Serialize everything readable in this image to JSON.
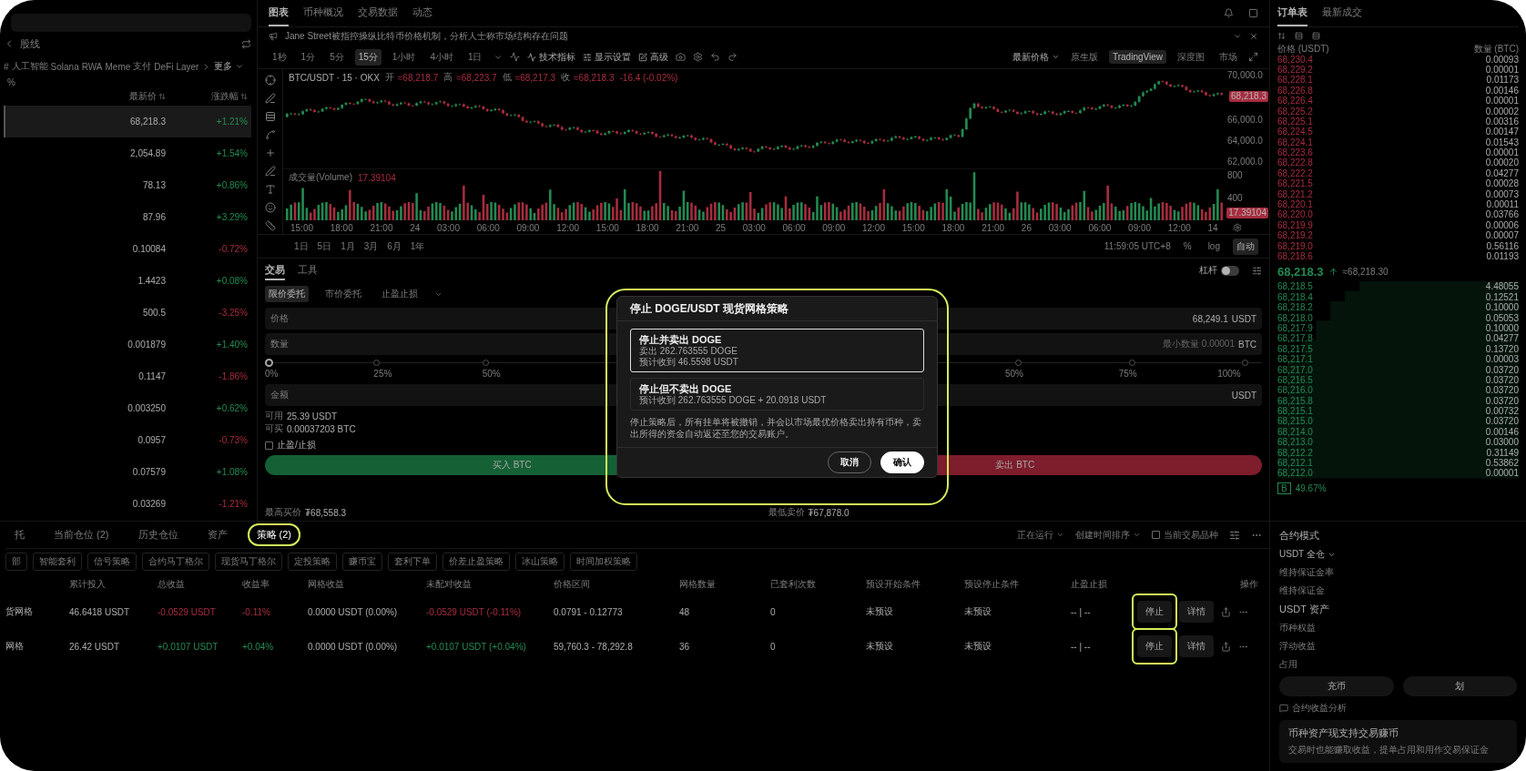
{
  "sidebar": {
    "title": "股线",
    "categories": [
      "#",
      "人工智能",
      "Solana",
      "RWA",
      "Meme",
      "支付",
      "DeFi",
      "Layer"
    ],
    "more": "更多",
    "filter": "%",
    "columns": [
      "最新价",
      "涨跌幅"
    ],
    "rows": [
      {
        "price": "68,218.3",
        "change": "+1.21%",
        "rising": true,
        "selected": true
      },
      {
        "price": "2,054.89",
        "change": "+1.54%",
        "rising": true,
        "selected": false
      },
      {
        "price": "78.13",
        "change": "+0.86%",
        "rising": true,
        "selected": false
      },
      {
        "price": "87.96",
        "change": "+3.29%",
        "rising": true,
        "selected": false
      },
      {
        "price": "0.10084",
        "change": "-0.72%",
        "rising": false,
        "selected": false
      },
      {
        "price": "1.4423",
        "change": "+0.08%",
        "rising": true,
        "selected": false
      },
      {
        "price": "500.5",
        "change": "-3.25%",
        "rising": false,
        "selected": false
      },
      {
        "price": "0.001879",
        "change": "+1.40%",
        "rising": true,
        "selected": false
      },
      {
        "price": "0.1147",
        "change": "-1.86%",
        "rising": false,
        "selected": false
      },
      {
        "price": "0.003250",
        "change": "+0.62%",
        "rising": true,
        "selected": false
      },
      {
        "price": "0.0957",
        "change": "-0.73%",
        "rising": false,
        "selected": false
      },
      {
        "price": "0.07579",
        "change": "+1.08%",
        "rising": true,
        "selected": false
      },
      {
        "price": "0.03269",
        "change": "-1.21%",
        "rising": false,
        "selected": false
      }
    ]
  },
  "chart": {
    "tabs": [
      {
        "label": "图表",
        "selected": true
      },
      {
        "label": "币种概况",
        "selected": false
      },
      {
        "label": "交易数据",
        "selected": false
      },
      {
        "label": "动态",
        "selected": false
      }
    ],
    "notice": "Jane Street被指控操纵比特币价格机制，分析人士称市场结构存在问题",
    "intervals": [
      {
        "label": "1秒",
        "selected": false
      },
      {
        "label": "1分",
        "selected": false
      },
      {
        "label": "5分",
        "selected": false
      },
      {
        "label": "15分",
        "selected": true
      },
      {
        "label": "1小时",
        "selected": false
      },
      {
        "label": "4小时",
        "selected": false
      },
      {
        "label": "1日",
        "selected": false
      }
    ],
    "tools": [
      "技术指标",
      "显示设置",
      "高级"
    ],
    "price_mode": "最新价格",
    "views": [
      {
        "label": "原生版",
        "selected": false
      },
      {
        "label": "TradingView",
        "selected": true
      },
      {
        "label": "深度图",
        "selected": false
      },
      {
        "label": "市场",
        "selected": false
      }
    ],
    "symbol": "BTC/USDT · 15 · OKX",
    "ohlc": [
      {
        "label": "开",
        "value": "≈68,218.7"
      },
      {
        "label": "高",
        "value": "≈68,223.7"
      },
      {
        "label": "低",
        "value": "≈68,217.3"
      },
      {
        "label": "收",
        "value": "≈68,218.3"
      }
    ],
    "ohlc_change": "-16.4 (-0.02%)",
    "price_ticks": [
      "70,000.0",
      "66,000.0",
      "64,000.0",
      "62,000.0"
    ],
    "last_price": "68,218.3",
    "volume_label": "成交量(Volume)",
    "volume_value": "17.39104",
    "volume_ticks": [
      "800",
      "400"
    ],
    "volume_tag": "17.39104",
    "time_ticks": [
      "15:00",
      "18:00",
      "21:00",
      "24",
      "03:00",
      "06:00",
      "09:00",
      "12:00",
      "15:00",
      "18:00",
      "21:00",
      "25",
      "03:00",
      "06:00",
      "09:00",
      "12:00",
      "15:00",
      "18:00",
      "21:00",
      "26",
      "03:00",
      "06:00",
      "09:00",
      "12:00",
      "14"
    ],
    "ranges": [
      "1日",
      "5日",
      "1月",
      "3月",
      "6月",
      "1年"
    ],
    "clock": "11:59:05 UTC+8",
    "scale_buttons": [
      {
        "label": "%",
        "selected": false
      },
      {
        "label": "log",
        "selected": false
      },
      {
        "label": "自动",
        "selected": true
      }
    ]
  },
  "trade": {
    "tabs": [
      {
        "label": "交易",
        "selected": true
      },
      {
        "label": "工具",
        "selected": false
      }
    ],
    "leverage": {
      "label": "杠杆",
      "on": false
    },
    "order_types": [
      {
        "label": "限价委托",
        "selected": true
      },
      {
        "label": "市价委托",
        "selected": false
      },
      {
        "label": "止盈止损",
        "selected": false
      }
    ],
    "price_field": {
      "label": "价格",
      "value": "68,249.1",
      "unit": "USDT"
    },
    "amount_field": {
      "label": "数量",
      "placeholder": "最小数量 0.00001",
      "unit": "BTC"
    },
    "buy_slider": {
      "level": 0,
      "marks": [
        "0%",
        "25%",
        "50%"
      ]
    },
    "sell_slider": {
      "level": 0,
      "marks": [
        "50%",
        "75%",
        "100%"
      ]
    },
    "total_field": {
      "label": "金额",
      "unit": "USDT"
    },
    "available": [
      {
        "label": "可用",
        "value": "25.39 USDT"
      },
      {
        "label": "可买",
        "value": "0.00037203 BTC"
      }
    ],
    "tpsl": {
      "label": "止盈/止损",
      "checked": false
    },
    "buy_button": "买入 BTC",
    "sell_button": "卖出 BTC",
    "max_buy": {
      "label": "最高买价",
      "value": "₮68,558.3"
    },
    "min_sell": {
      "label": "最低卖价",
      "value": "₮67,878.0"
    }
  },
  "orders": {
    "tabs": [
      {
        "label": "托",
        "selected": false,
        "highlighted": false
      },
      {
        "label": "当前仓位 (2)",
        "selected": false,
        "highlighted": false
      },
      {
        "label": "历史仓位",
        "selected": false,
        "highlighted": false
      },
      {
        "label": "资产",
        "selected": false,
        "highlighted": false
      },
      {
        "label": "策略 (2)",
        "selected": true,
        "highlighted": true
      }
    ],
    "status_filter": "正在运行",
    "sort": "创建时间排序",
    "current_only": {
      "label": "当前交易品种",
      "checked": false
    },
    "chips": [
      "部",
      "智能套利",
      "信号策略",
      "合约马丁格尔",
      "现货马丁格尔",
      "定投策略",
      "赚币宝",
      "套利下单",
      "价差止盈策略",
      "冰山策略",
      "时间加权策略"
    ],
    "columns": [
      "累计投入",
      "总收益",
      "收益率",
      "网格收益",
      "未配对收益",
      "价格区间",
      "网格数量",
      "已套利次数",
      "预设开始条件",
      "预设停止条件",
      "止盈止损",
      "操作"
    ],
    "rows": [
      {
        "name": "货网格",
        "invested": "46.6418 USDT",
        "profit": "-0.0529 USDT",
        "rate": "-0.11%",
        "grid_profit": "0.0000 USDT (0.00%)",
        "unpaired": "-0.0529 USDT (-0.11%)",
        "range": "0.0791 - 0.12773",
        "grids": "48",
        "arbitrage": "0",
        "start": "未预设",
        "stop": "未预设",
        "tpsl": "-- | --",
        "rising": false,
        "stop_button": "停止",
        "detail_button": "详情",
        "highlighted": true
      },
      {
        "name": "网格",
        "invested": "26.42 USDT",
        "profit": "+0.0107 USDT",
        "rate": "+0.04%",
        "grid_profit": "0.0000 USDT (0.00%)",
        "unpaired": "+0.0107 USDT (+0.04%)",
        "range": "59,760.3 - 78,292.8",
        "grids": "36",
        "arbitrage": "0",
        "start": "未预设",
        "stop": "未预设",
        "tpsl": "-- | --",
        "rising": true,
        "stop_button": "停止",
        "detail_button": "详情",
        "highlighted": true
      }
    ]
  },
  "book": {
    "tabs": [
      {
        "label": "订单表",
        "selected": true
      },
      {
        "label": "最新成交",
        "selected": false
      }
    ],
    "columns": [
      "价格 (USDT)",
      "数量 (BTC)"
    ],
    "asks": [
      {
        "price": "68,230.4",
        "amount": "0.00093"
      },
      {
        "price": "68,229.2",
        "amount": "0.00001"
      },
      {
        "price": "68,228.1",
        "amount": "0.01173"
      },
      {
        "price": "68,226.8",
        "amount": "0.00146"
      },
      {
        "price": "68,226.4",
        "amount": "0.00001"
      },
      {
        "price": "68,225.2",
        "amount": "0.00002"
      },
      {
        "price": "68,225.1",
        "amount": "0.00316"
      },
      {
        "price": "68,224.5",
        "amount": "0.00147"
      },
      {
        "price": "68,224.1",
        "amount": "0.01543"
      },
      {
        "price": "68,223.6",
        "amount": "0.00001"
      },
      {
        "price": "68,222.8",
        "amount": "0.00020"
      },
      {
        "price": "68,222.2",
        "amount": "0.04277"
      },
      {
        "price": "68,221.5",
        "amount": "0.00028"
      },
      {
        "price": "68,221.2",
        "amount": "0.00073"
      },
      {
        "price": "68,220.1",
        "amount": "0.00011"
      },
      {
        "price": "68,220.0",
        "amount": "0.03766"
      },
      {
        "price": "68,219.9",
        "amount": "0.00006"
      },
      {
        "price": "68,219.2",
        "amount": "0.00007"
      },
      {
        "price": "68,219.0",
        "amount": "0.56116"
      },
      {
        "price": "68,218.6",
        "amount": "0.01193"
      }
    ],
    "last": {
      "price": "68,218.3",
      "mark": "≈68,218.30"
    },
    "bids": [
      {
        "price": "68,218.5",
        "amount": "4.48055"
      },
      {
        "price": "68,218.4",
        "amount": "0.12521"
      },
      {
        "price": "68,218.2",
        "amount": "0.10000"
      },
      {
        "price": "68,218.0",
        "amount": "0.05053"
      },
      {
        "price": "68,217.9",
        "amount": "0.10000"
      },
      {
        "price": "68,217.8",
        "amount": "0.04277"
      },
      {
        "price": "68,217.5",
        "amount": "0.13720"
      },
      {
        "price": "68,217.1",
        "amount": "0.00003"
      },
      {
        "price": "68,217.0",
        "amount": "0.03720"
      },
      {
        "price": "68,216.5",
        "amount": "0.03720"
      },
      {
        "price": "68,216.0",
        "amount": "0.03720"
      },
      {
        "price": "68,215.8",
        "amount": "0.03720"
      },
      {
        "price": "68,215.1",
        "amount": "0.00732"
      },
      {
        "price": "68,215.0",
        "amount": "0.03720"
      },
      {
        "price": "68,214.0",
        "amount": "0.00146"
      },
      {
        "price": "68,213.0",
        "amount": "0.03000"
      },
      {
        "price": "68,212.2",
        "amount": "0.31149"
      },
      {
        "price": "68,212.1",
        "amount": "0.53862"
      },
      {
        "price": "68,212.0",
        "amount": "0.00001"
      }
    ],
    "ratio_badge": "B",
    "ratio": "49.67%"
  },
  "account": {
    "title": "合约模式",
    "mode": "USDT 全仓",
    "margin": [
      "维持保证金率",
      "维持保证金"
    ],
    "assets_title": "USDT 资产",
    "assets": [
      "币种权益",
      "浮动收益",
      "占用"
    ],
    "buttons": [
      "充币",
      "划"
    ],
    "analysis": "合约收益分析",
    "promo": {
      "title": "币种资产现支持交易赚币",
      "text": "交易时也能赚取收益，提单占用和用作交易保证金"
    }
  },
  "modal": {
    "title": "停止 DOGE/USDT 现货网格策略",
    "highlighted": true,
    "options": [
      {
        "title": "停止并卖出 DOGE",
        "lines": [
          "卖出 262.763555 DOGE",
          "预计收到 46.5598 USDT"
        ],
        "selected": true
      },
      {
        "title": "停止但不卖出 DOGE",
        "lines": [
          "预计收到 262.763555 DOGE + 20.0918 USDT"
        ],
        "selected": false
      }
    ],
    "note": "停止策略后，所有挂单将被撤销，并会以市场最优价格卖出持有币种，卖出所得的资金自动返还至您的交易账户。",
    "cancel": "取消",
    "confirm": "确认"
  }
}
